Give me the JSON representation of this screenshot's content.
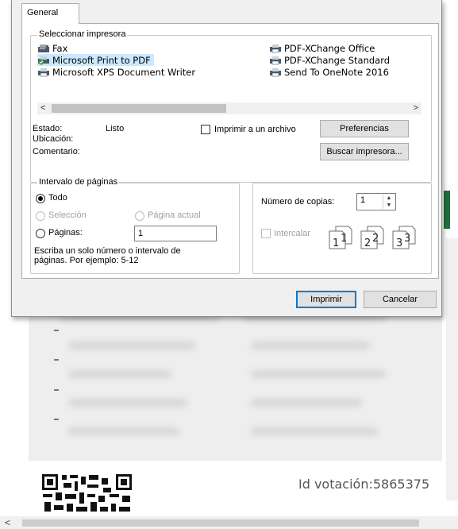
{
  "dialog": {
    "tab_label": "General",
    "select_printer": {
      "legend": "Seleccionar impresora",
      "printers_left": [
        {
          "name": "Fax",
          "icon": "fax-icon"
        },
        {
          "name": "Microsoft Print to PDF",
          "icon": "printer-default-icon",
          "selected": true
        },
        {
          "name": "Microsoft XPS Document Writer",
          "icon": "printer-icon"
        }
      ],
      "printers_right": [
        {
          "name": "PDF-XChange Office",
          "icon": "printer-icon"
        },
        {
          "name": "PDF-XChange Standard",
          "icon": "printer-icon"
        },
        {
          "name": "Send To OneNote 2016",
          "icon": "printer-icon"
        }
      ],
      "scroll_left": "<",
      "scroll_right": ">",
      "status_label": "Estado:",
      "status_value": "Listo",
      "location_label": "Ubicación:",
      "comment_label": "Comentario:",
      "print_to_file_label": "Imprimir a un archivo",
      "preferences_button": "Preferencias",
      "find_printer_button": "Buscar impresora..."
    },
    "page_range": {
      "legend": "Intervalo de páginas",
      "all_label": "Todo",
      "selection_label": "Selección",
      "current_page_label": "Página actual",
      "pages_label": "Páginas:",
      "pages_value": "1",
      "hint": "Escriba un solo número o intervalo de páginas. Por ejemplo: 5-12"
    },
    "copies": {
      "label": "Número de copias:",
      "value": "1",
      "collate_label": "Intercalar"
    },
    "print_button": "Imprimir",
    "cancel_button": "Cancelar"
  },
  "background": {
    "vote_id_text": "Id votación:5865375",
    "scroll_left": "<"
  },
  "colors": {
    "selection": "#cce8ff",
    "accent_border": "#0078d7",
    "dialog_bg": "#f0f0f0"
  }
}
